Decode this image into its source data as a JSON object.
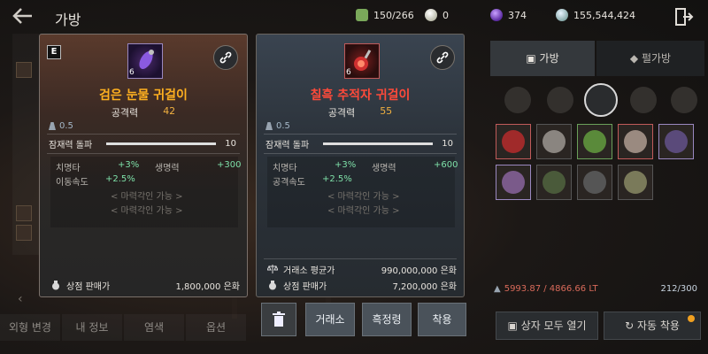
{
  "header": {
    "title": "가방",
    "back_icon": "back-arrow-icon",
    "currencies": [
      {
        "icon": "weight-icon",
        "value": "150/266"
      },
      {
        "icon": "pearl-icon",
        "value": "0"
      },
      {
        "icon": "gem-icon",
        "value": "374"
      },
      {
        "icon": "silver-icon",
        "value": "155,544,424"
      }
    ],
    "exit_icon": "exit-door-icon"
  },
  "left_card": {
    "grade": "E",
    "enhancement": "6",
    "name": "검은 눈물 귀걸이",
    "attack_label": "공격력",
    "attack_value": "42",
    "weight": "0.5",
    "break_label": "잠재력 돌파",
    "break_value": "10",
    "stats": [
      {
        "label": "치명타",
        "value": "+3%"
      },
      {
        "label": "생명력",
        "value": "+300"
      },
      {
        "label": "이동속도",
        "value": "+2.5%"
      }
    ],
    "notes": [
      "< 마력각인 가능 >",
      "< 마력각인 가능 >"
    ],
    "sell_label": "상점 판매가",
    "sell_value": "1,800,000 은화"
  },
  "right_card": {
    "enhancement": "6",
    "name": "칠흑 추적자 귀걸이",
    "attack_label": "공격력",
    "attack_value": "55",
    "weight": "0.5",
    "break_label": "잠재력 돌파",
    "break_value": "10",
    "stats": [
      {
        "label": "치명타",
        "value": "+3%"
      },
      {
        "label": "생명력",
        "value": "+600"
      },
      {
        "label": "공격속도",
        "value": "+2.5%"
      }
    ],
    "notes": [
      "< 마력각인 가능 >",
      "< 마력각인 가능 >"
    ],
    "market_label": "거래소 평균가",
    "market_value": "990,000,000 은화",
    "sell_label": "상점 판매가",
    "sell_value": "7,200,000 은화"
  },
  "actions": {
    "delete_icon": "trash-icon",
    "exchange": "거래소",
    "black_spirit": "흑정령",
    "equip": "착용"
  },
  "bottom_tabs": [
    "외형 변경",
    "내 정보",
    "염색",
    "옵션"
  ],
  "right_panel": {
    "tab_bag": "가방",
    "tab_pearl": "펄가방",
    "weight_text": "5993.87 / 4866.66 LT",
    "slot_count": "212/300",
    "open_all": "상자 모두 열기",
    "auto_equip": "자동 착용"
  }
}
